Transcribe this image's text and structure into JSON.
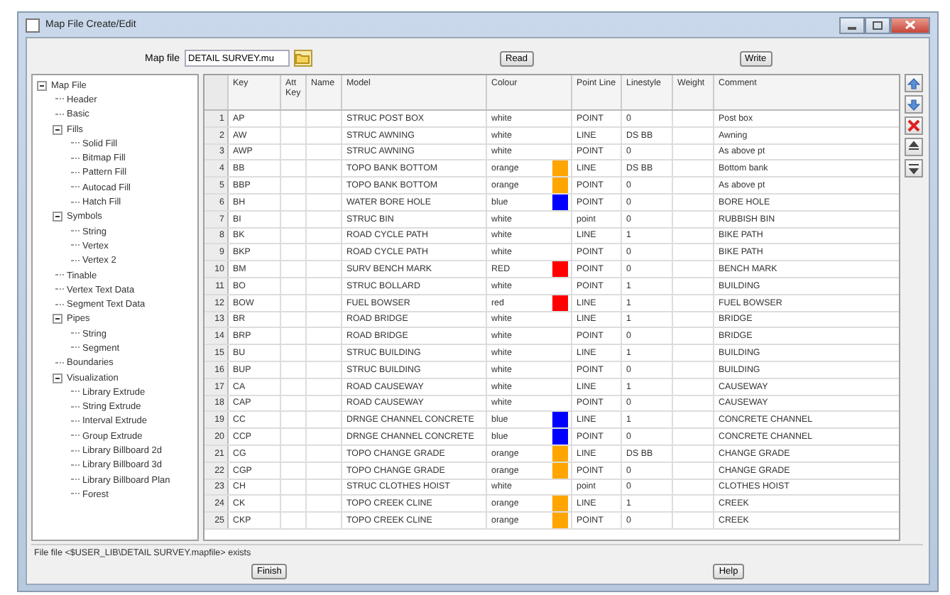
{
  "window": {
    "title": "Map File Create/Edit"
  },
  "map_file": {
    "label": "Map file",
    "value": "DETAIL SURVEY.mu"
  },
  "top_buttons": [
    "Read",
    "Write"
  ],
  "tree": [
    {
      "label": "Map File",
      "expanded": true,
      "children": [
        {
          "label": "Header"
        },
        {
          "label": "Basic"
        },
        {
          "label": "Fills",
          "expanded": true,
          "children": [
            {
              "label": "Solid Fill"
            },
            {
              "label": "Bitmap Fill"
            },
            {
              "label": "Pattern Fill"
            },
            {
              "label": "Autocad Fill"
            },
            {
              "label": "Hatch Fill"
            }
          ]
        },
        {
          "label": "Symbols",
          "expanded": true,
          "children": [
            {
              "label": "String"
            },
            {
              "label": "Vertex"
            },
            {
              "label": "Vertex 2"
            }
          ]
        },
        {
          "label": "Tinable"
        },
        {
          "label": "Vertex Text Data"
        },
        {
          "label": "Segment Text Data"
        },
        {
          "label": "Pipes",
          "expanded": true,
          "children": [
            {
              "label": "String"
            },
            {
              "label": "Segment"
            }
          ]
        },
        {
          "label": "Boundaries"
        },
        {
          "label": "Visualization",
          "expanded": true,
          "children": [
            {
              "label": "Library Extrude"
            },
            {
              "label": "String Extrude"
            },
            {
              "label": "Interval Extrude"
            },
            {
              "label": "Group Extrude"
            },
            {
              "label": "Library Billboard 2d"
            },
            {
              "label": "Library Billboard 3d"
            },
            {
              "label": "Library Billboard Plan"
            },
            {
              "label": "Forest"
            }
          ]
        }
      ]
    }
  ],
  "table": {
    "columns": [
      "Key",
      "Att Key",
      "Name",
      "Model",
      "Colour",
      "Point Line",
      "Linestyle",
      "Weight",
      "Comment"
    ],
    "rows": [
      {
        "num": "1",
        "key": "AP",
        "model": "STRUC POST BOX",
        "colour": "white",
        "point_line": "POINT",
        "linestyle": "0",
        "comment": "Post box"
      },
      {
        "num": "2",
        "key": "AW",
        "model": "STRUC AWNING",
        "colour": "white",
        "point_line": "LINE",
        "linestyle": "DS BB",
        "comment": "Awning"
      },
      {
        "num": "3",
        "key": "AWP",
        "model": "STRUC AWNING",
        "colour": "white",
        "point_line": "POINT",
        "linestyle": "0",
        "comment": "As above pt"
      },
      {
        "num": "4",
        "key": "BB",
        "model": "TOPO BANK BOTTOM",
        "colour": "orange",
        "color": "#ffa500",
        "point_line": "LINE",
        "linestyle": "DS BB",
        "comment": "Bottom bank"
      },
      {
        "num": "5",
        "key": "BBP",
        "model": "TOPO BANK BOTTOM",
        "colour": "orange",
        "color": "#ffa500",
        "point_line": "POINT",
        "linestyle": "0",
        "comment": "As above pt"
      },
      {
        "num": "6",
        "key": "BH",
        "model": "WATER BORE HOLE",
        "colour": "blue",
        "color": "#0000ff",
        "point_line": "POINT",
        "linestyle": "0",
        "comment": "BORE HOLE"
      },
      {
        "num": "7",
        "key": "BI",
        "model": "STRUC BIN",
        "colour": "white",
        "point_line": "point",
        "linestyle": "0",
        "comment": "RUBBISH BIN"
      },
      {
        "num": "8",
        "key": "BK",
        "model": "ROAD CYCLE PATH",
        "colour": "white",
        "point_line": "LINE",
        "linestyle": "1",
        "comment": "BIKE PATH"
      },
      {
        "num": "9",
        "key": "BKP",
        "model": "ROAD CYCLE PATH",
        "colour": "white",
        "point_line": "POINT",
        "linestyle": "0",
        "comment": "BIKE PATH"
      },
      {
        "num": "10",
        "key": "BM",
        "model": "SURV BENCH MARK",
        "colour": "RED",
        "color": "#ff0000",
        "point_line": "POINT",
        "linestyle": "0",
        "comment": "BENCH MARK"
      },
      {
        "num": "11",
        "key": "BO",
        "model": "STRUC BOLLARD",
        "colour": "white",
        "point_line": "POINT",
        "linestyle": "1",
        "comment": "BUILDING"
      },
      {
        "num": "12",
        "key": "BOW",
        "model": "FUEL BOWSER",
        "colour": "red",
        "color": "#ff0000",
        "point_line": "LINE",
        "linestyle": "1",
        "comment": "FUEL BOWSER"
      },
      {
        "num": "13",
        "key": "BR",
        "model": "ROAD BRIDGE",
        "colour": "white",
        "point_line": "LINE",
        "linestyle": "1",
        "comment": "BRIDGE"
      },
      {
        "num": "14",
        "key": "BRP",
        "model": "ROAD BRIDGE",
        "colour": "white",
        "point_line": "POINT",
        "linestyle": "0",
        "comment": "BRIDGE"
      },
      {
        "num": "15",
        "key": "BU",
        "model": "STRUC BUILDING",
        "colour": "white",
        "point_line": "LINE",
        "linestyle": "1",
        "comment": "BUILDING"
      },
      {
        "num": "16",
        "key": "BUP",
        "model": "STRUC BUILDING",
        "colour": "white",
        "point_line": "POINT",
        "linestyle": "0",
        "comment": "BUILDING"
      },
      {
        "num": "17",
        "key": "CA",
        "model": "ROAD CAUSEWAY",
        "colour": "white",
        "point_line": "LINE",
        "linestyle": "1",
        "comment": "CAUSEWAY"
      },
      {
        "num": "18",
        "key": "CAP",
        "model": "ROAD CAUSEWAY",
        "colour": "white",
        "point_line": "POINT",
        "linestyle": "0",
        "comment": "CAUSEWAY"
      },
      {
        "num": "19",
        "key": "CC",
        "model": "DRNGE CHANNEL CONCRETE",
        "colour": "blue",
        "color": "#0000ff",
        "point_line": "LINE",
        "linestyle": "1",
        "comment": "CONCRETE CHANNEL"
      },
      {
        "num": "20",
        "key": "CCP",
        "model": "DRNGE CHANNEL CONCRETE",
        "colour": "blue",
        "color": "#0000ff",
        "point_line": "POINT",
        "linestyle": "0",
        "comment": "CONCRETE CHANNEL"
      },
      {
        "num": "21",
        "key": "CG",
        "model": "TOPO CHANGE GRADE",
        "colour": "orange",
        "color": "#ffa500",
        "point_line": "LINE",
        "linestyle": "DS BB",
        "comment": "CHANGE GRADE"
      },
      {
        "num": "22",
        "key": "CGP",
        "model": "TOPO CHANGE GRADE",
        "colour": "orange",
        "color": "#ffa500",
        "point_line": "POINT",
        "linestyle": "0",
        "comment": "CHANGE GRADE"
      },
      {
        "num": "23",
        "key": "CH",
        "model": "STRUC CLOTHES HOIST",
        "colour": "white",
        "point_line": "point",
        "linestyle": "0",
        "comment": "CLOTHES HOIST"
      },
      {
        "num": "24",
        "key": "CK",
        "model": "TOPO CREEK CLINE",
        "colour": "orange",
        "color": "#ffa500",
        "point_line": "LINE",
        "linestyle": "1",
        "comment": "CREEK"
      },
      {
        "num": "25",
        "key": "CKP",
        "model": "TOPO CREEK CLINE",
        "colour": "orange",
        "color": "#ffa500",
        "point_line": "POINT",
        "linestyle": "0",
        "comment": "CREEK"
      }
    ]
  },
  "status": "File file <$USER_LIB\\DETAIL SURVEY.mapfile> exists",
  "bottom_buttons": [
    "Finish",
    "Help"
  ]
}
